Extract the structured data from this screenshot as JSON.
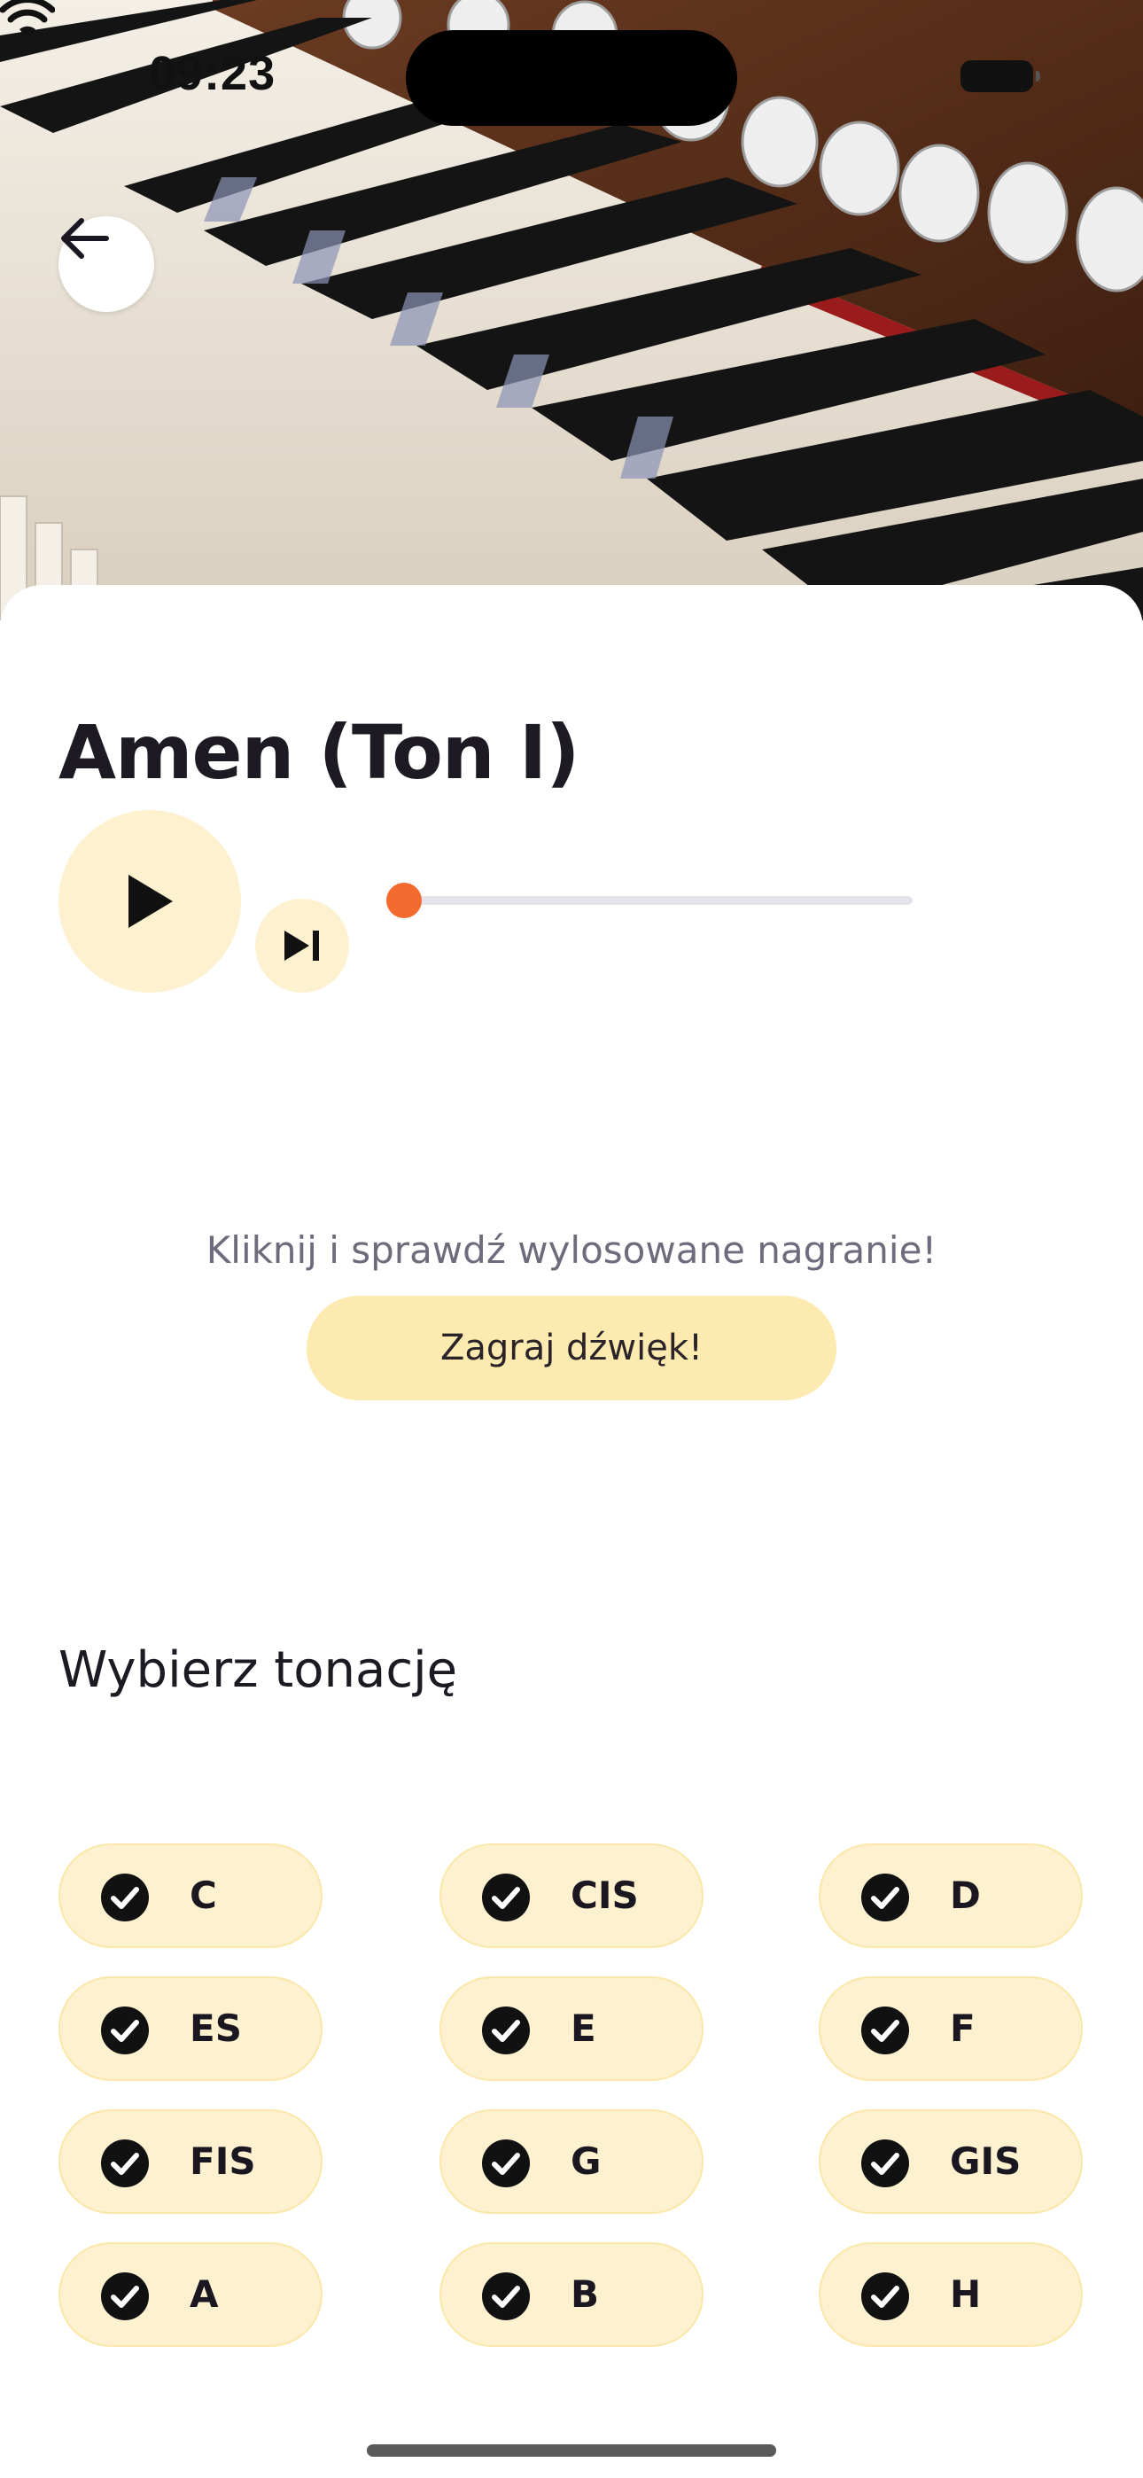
{
  "status_bar": {
    "time": "09:23"
  },
  "header": {
    "image": "organ-keyboard-photo",
    "back_icon": "arrow-left-icon"
  },
  "player": {
    "title": "Amen (Ton I)",
    "play_icon": "play-icon",
    "skip_icon": "skip-next-icon",
    "progress": 0.0
  },
  "prompt": {
    "hint": "Kliknij i sprawdź wylosowane nagranie!",
    "play_sound_label": "Zagraj dźwięk!"
  },
  "keys": {
    "title": "Wybierz tonację",
    "items": [
      {
        "label": "C",
        "checked": true
      },
      {
        "label": "CIS",
        "checked": true
      },
      {
        "label": "D",
        "checked": true
      },
      {
        "label": "ES",
        "checked": true
      },
      {
        "label": "E",
        "checked": true
      },
      {
        "label": "F",
        "checked": true
      },
      {
        "label": "FIS",
        "checked": true
      },
      {
        "label": "G",
        "checked": true
      },
      {
        "label": "GIS",
        "checked": true
      },
      {
        "label": "A",
        "checked": true
      },
      {
        "label": "B",
        "checked": true
      },
      {
        "label": "H",
        "checked": true
      }
    ]
  },
  "colors": {
    "accent": "#f26a2e",
    "chip_bg": "#fdf1cf",
    "button_bg": "#fdeab0",
    "text_dark": "#1d1a24",
    "text_muted": "#6f6b7c"
  }
}
